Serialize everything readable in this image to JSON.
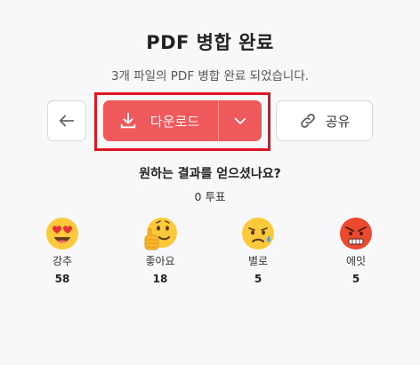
{
  "header": {
    "title": "PDF 병합 완료",
    "subtitle": "3개 파일의 PDF 병합 완료 되었습니다."
  },
  "actions": {
    "back_icon": "arrow-left-icon",
    "download_label": "다운로드",
    "download_icon": "download-icon",
    "dropdown_icon": "chevron-down-icon",
    "share_label": "공유",
    "share_icon": "link-icon",
    "accent_color": "#f0595b",
    "highlight_color": "#e0141e"
  },
  "feedback": {
    "question": "원하는 결과를 얻으셨나요?",
    "votes": "0 투표",
    "reactions": [
      {
        "label": "강추",
        "count": "58",
        "icon": "heart-eyes-emoji-icon"
      },
      {
        "label": "좋아요",
        "count": "18",
        "icon": "thumbs-up-emoji-icon"
      },
      {
        "label": "별로",
        "count": "5",
        "icon": "sad-emoji-icon"
      },
      {
        "label": "에잇",
        "count": "5",
        "icon": "angry-emoji-icon"
      }
    ]
  }
}
